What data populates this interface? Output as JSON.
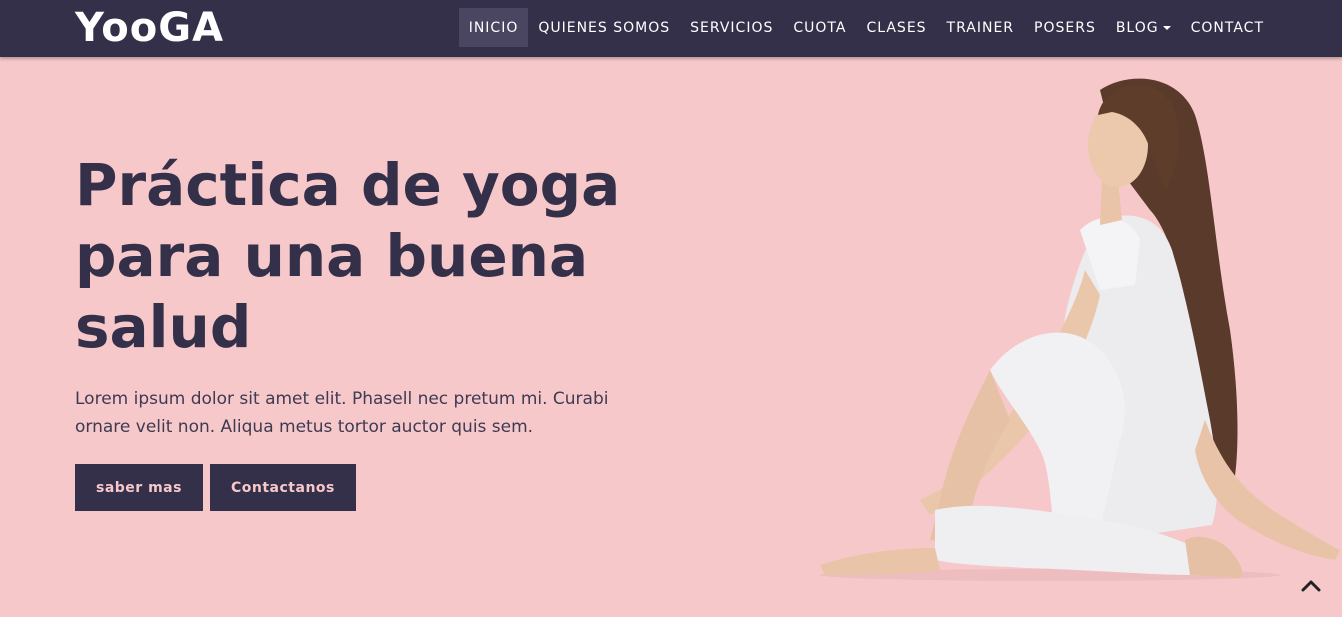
{
  "brand": {
    "name": "YooGA"
  },
  "nav": {
    "items": [
      {
        "label": "INICIO",
        "active": true
      },
      {
        "label": "QUIENES SOMOS",
        "active": false
      },
      {
        "label": "SERVICIOS",
        "active": false
      },
      {
        "label": "CUOTA",
        "active": false
      },
      {
        "label": "CLASES",
        "active": false
      },
      {
        "label": "TRAINER",
        "active": false
      },
      {
        "label": "POSERS",
        "active": false
      },
      {
        "label": "BLOG",
        "active": false,
        "dropdown": true
      },
      {
        "label": "CONTACT",
        "active": false
      }
    ]
  },
  "hero": {
    "title_lines": [
      "Práctica de yoga",
      "para una buena",
      "salud"
    ],
    "text_lines": [
      "Lorem ipsum dolor sit amet elit. Phasell nec pretum mi. Curabi",
      "ornare velit non. Aliqua metus tortor auctor quis sem."
    ],
    "buttons": {
      "primary": "saber mas",
      "secondary": "Contactanos"
    },
    "image_icon": "yoga-woman-pose-image"
  },
  "scroll_top": {
    "icon": "chevron-up-icon"
  },
  "colors": {
    "navbar": "#34304a",
    "background": "#f7c8ca",
    "heading": "#34304a",
    "button_bg": "#34304a",
    "button_text": "#f7c8ca",
    "active_nav": "#4a4661"
  }
}
